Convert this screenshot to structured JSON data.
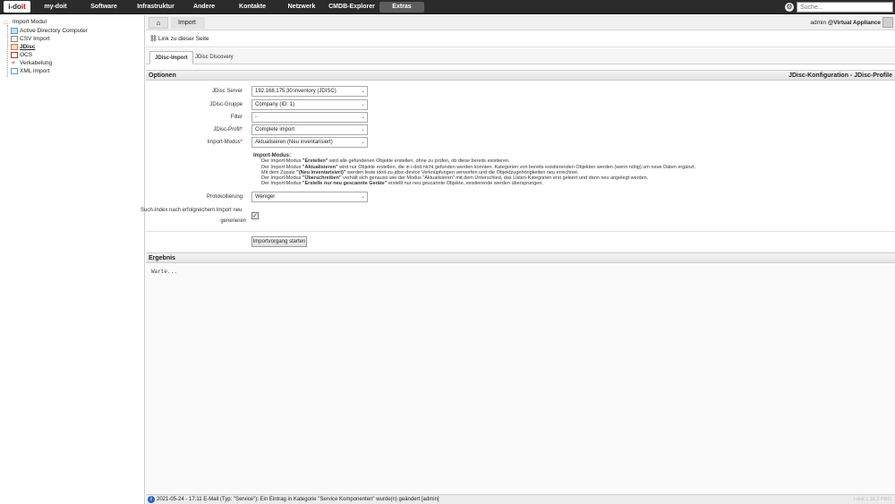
{
  "logo": {
    "text_a": "i-do",
    "text_b": "it"
  },
  "nav": {
    "items": [
      "my-doit",
      "Software",
      "Infrastruktur",
      "Andere",
      "Kontakte",
      "Netzwerk",
      "CMDB-Explorer",
      "Extras"
    ],
    "active": "Extras"
  },
  "search": {
    "placeholder": "Suche..."
  },
  "tree": {
    "root": "Import Modul",
    "items": [
      "Active Directory Computer",
      "CSV Import",
      "JDisc",
      "OCS",
      "Verkabelung",
      "XML Import"
    ],
    "selected": "JDisc"
  },
  "breadcrumb": {
    "home_icon": "home-icon",
    "current": "Import"
  },
  "user": {
    "name": "admin",
    "tenant": "@Virtual Appliance"
  },
  "link_row": {
    "label": "Link zu dieser Seite"
  },
  "tabs": [
    "JDisc-Import",
    "JDisc Discovery"
  ],
  "options": {
    "title": "Optionen",
    "right_title": "JDisc-Konfiguration - JDisc-Profile",
    "fields": {
      "server": {
        "label": "JDisc Server",
        "value": "192.168.175.30:inventory (JDISC)"
      },
      "group": {
        "label": "JDisc-Gruppe",
        "value": "Company (ID: 1)"
      },
      "filter": {
        "label": "Filter",
        "value": "-"
      },
      "profile": {
        "label": "JDisc-Profil",
        "value": "Complete import"
      },
      "mode": {
        "label": "Import-Modus",
        "value": "Aktualisieren (Neu inventarisiert)"
      },
      "logging": {
        "label": "Protokollierung",
        "value": "Weniger"
      }
    },
    "help": {
      "title": "Import-Modus:",
      "l1a": "Der Import-Modus ",
      "l1b": "\"Erstellen\"",
      "l1c": " wird alle gefundenen Objekte erstellen, ohne zu prüfen, ob diese bereits existieren.",
      "l2a": "Der Import-Modus ",
      "l2b": "\"Aktualisieren\"",
      "l2c": " wird nur Objekte erstellen, die in i-doit nicht gefunden werden konnten. Kategorien von bereits existierenden Objekten werden (wenn nötig) um neue Daten ergänzt.",
      "l3a": "Mit dem Zusatz ",
      "l3b": "\"(Neu inventarisiert)\"",
      "l3c": " werden feste idoit-zu-jdisc-device Verknüpfungen verworfen und die Objektzugehörigkeiten neu errechnet.",
      "l4a": "Der Import-Modus ",
      "l4b": "\"Überschreiben\"",
      "l4c": " verhält sich genauso wie der Modus \"Aktualisieren\" mit dem Unterschied, das Listen-Kategorien erst geleert und dann neu angelegt werden.",
      "l5a": "Der Import-Modus ",
      "l5b": "\"Erstelle nur neu gescannte Geräte\"",
      "l5c": " erstellt nur neu gescannte Objekte, existierende werden übersprungen."
    },
    "reindex": {
      "label_line1": "Such-Index nach erfolgreichem Import neu",
      "label_line2": "generieren",
      "checked": true
    },
    "start_button": "Importvorgang starten"
  },
  "result": {
    "title": "Ergebnis",
    "text": "Warte..."
  },
  "status": {
    "message": "2021-05-24 - 17:11 E-Mail (Typ: \"Service\"): Ein Eintrag in Kategorie \"Service Komponenten\" wurde(n) geändert [admin]",
    "version": "i-doit 1.16.2 PRO"
  }
}
